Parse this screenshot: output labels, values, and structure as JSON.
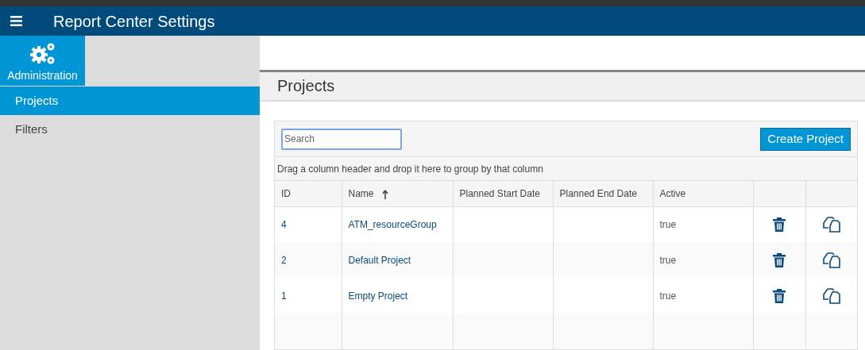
{
  "header": {
    "title": "Report Center Settings"
  },
  "sidebar": {
    "tile": {
      "label": "Administration"
    },
    "items": [
      {
        "label": "Projects",
        "selected": true
      },
      {
        "label": "Filters",
        "selected": false
      }
    ]
  },
  "page": {
    "title": "Projects"
  },
  "grid": {
    "search": {
      "placeholder": "Search"
    },
    "create_button": "Create Project",
    "group_hint": "Drag a column header and drop it here to group by that column",
    "columns": [
      {
        "label": "ID",
        "sorted": false
      },
      {
        "label": "Name",
        "sorted": true
      },
      {
        "label": "Planned Start Date",
        "sorted": false
      },
      {
        "label": "Planned End Date",
        "sorted": false
      },
      {
        "label": "Active",
        "sorted": false
      }
    ],
    "rows": [
      {
        "id": "4",
        "name": "ATM_resourceGroup",
        "start": "",
        "end": "",
        "active": "true"
      },
      {
        "id": "2",
        "name": "Default Project",
        "start": "",
        "end": "",
        "active": "true"
      },
      {
        "id": "1",
        "name": "Empty Project",
        "start": "",
        "end": "",
        "active": "true"
      }
    ]
  }
}
